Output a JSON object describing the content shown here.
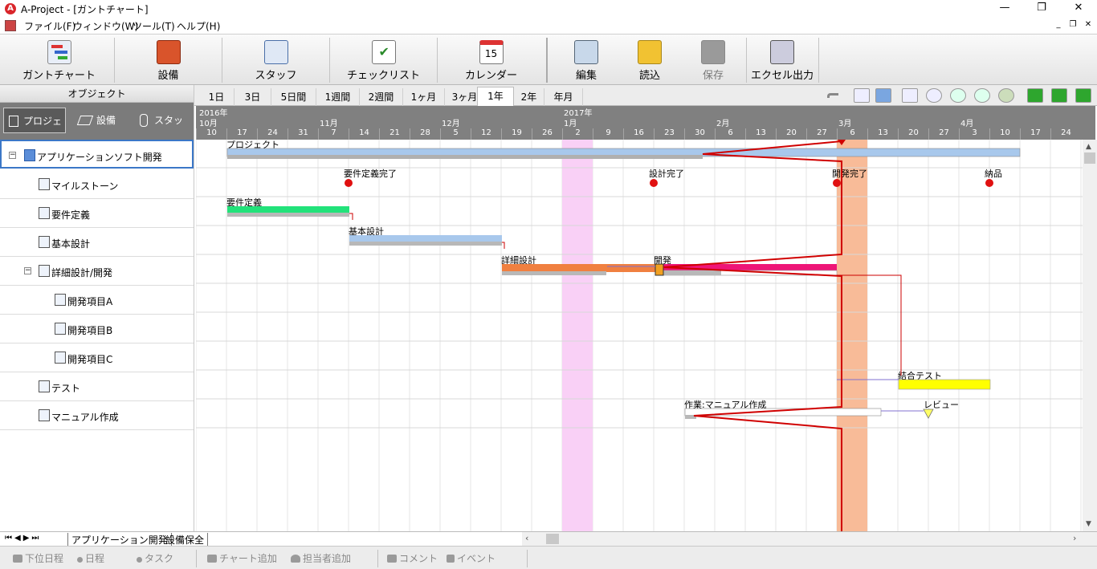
{
  "window": {
    "title": "A-Project - [ガントチャート]",
    "minimize": "—",
    "maximize": "❐",
    "close": "✕"
  },
  "menu": [
    "ファイル(F)",
    "ウィンドウ(W)",
    "ツール(T)",
    "ヘルプ(H)"
  ],
  "toolbar": {
    "gantt": "ガントチャート",
    "equipment": "設備",
    "staff": "スタッフ",
    "checklist": "チェックリスト",
    "calendar": "カレンダー",
    "calendar_day": "15",
    "edit": "編集",
    "load": "読込",
    "save": "保存",
    "excel": "エクセル出力"
  },
  "object_panel": {
    "header": "オブジェクト",
    "tabs": [
      "プロジェクト",
      "設備",
      "スタッフ"
    ]
  },
  "tree": [
    "アプリケーションソフト開発",
    "マイルストーン",
    "要件定義",
    "基本設計",
    "詳細設計/開発",
    "開発項目A",
    "開発項目B",
    "開発項目C",
    "テスト",
    "マニュアル作成"
  ],
  "scale_tabs": [
    "1日",
    "3日",
    "5日間",
    "1週間",
    "2週間",
    "1ヶ月",
    "3ヶ月",
    "1年",
    "2年",
    "年月"
  ],
  "selected_scale": "1年",
  "timeline": {
    "years": [
      "2016年",
      "2017年"
    ],
    "months": [
      "10月",
      "11月",
      "12月",
      "1月",
      "2月",
      "3月",
      "4月"
    ],
    "days": [
      "10",
      "17",
      "24",
      "31",
      "7",
      "14",
      "21",
      "28",
      "5",
      "12",
      "19",
      "26",
      "2",
      "9",
      "16",
      "23",
      "30",
      "6",
      "13",
      "20",
      "27",
      "6",
      "13",
      "20",
      "27",
      "3",
      "10",
      "17",
      "24"
    ]
  },
  "chart_labels": {
    "project": "プロジェクト",
    "m1": "要件定義完了",
    "m2": "設計完了",
    "m3": "開発完了",
    "m4": "納品",
    "req": "要件定義",
    "basic": "基本設計",
    "detail": "詳細設計",
    "dev": "開発",
    "integ": "結合テスト",
    "manual": "作業:マニュアル作成",
    "review": "レビュー"
  },
  "bottom_tabs": [
    "アプリケーション開発",
    "設備保全"
  ],
  "status_buttons": [
    "下位日程",
    "日程",
    "タスク",
    "チャート追加",
    "担当者追加",
    "コメント",
    "イベント"
  ],
  "colors": {
    "progress_line": "#d00000",
    "today_band": "#f8bb98",
    "holiday_band": "#f9d0f6",
    "bar_blue": "#a8c8ec",
    "bar_green": "#22e27a",
    "bar_orange": "#f08040",
    "bar_pink": "#ee1577",
    "bar_yellow": "#ffff00"
  }
}
